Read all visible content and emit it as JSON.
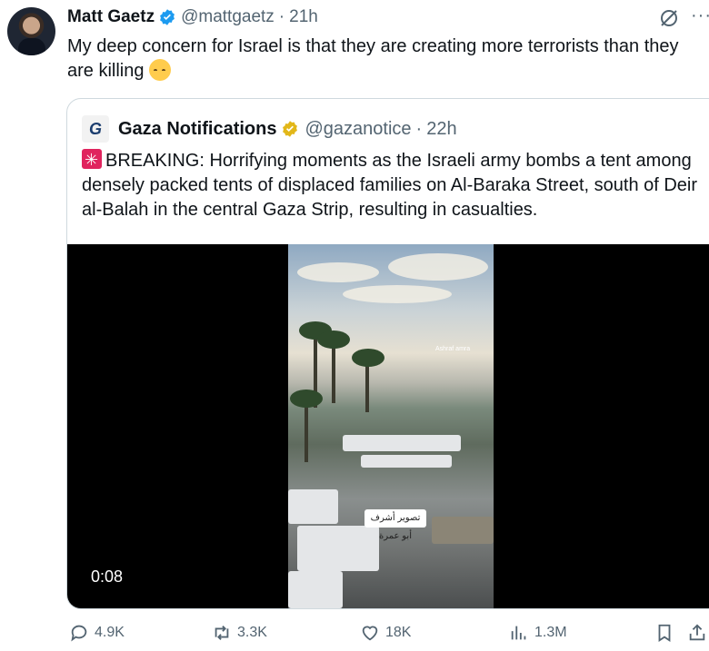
{
  "tweet": {
    "author_name": "Matt Gaetz",
    "handle": "@mattgaetz",
    "separator": "·",
    "time": "21h",
    "text": "My deep concern for Israel is that they are creating more terrorists than they are killing",
    "more_label": "···"
  },
  "quote": {
    "author_name": "Gaza Notifications",
    "avatar_letter": "G",
    "handle": "@gazanotice",
    "separator": "·",
    "time": "22h",
    "text": "BREAKING: Horrifying moments as the Israeli army bombs a tent among densely packed tents of displaced families on Al-Baraka Street, south of Deir al-Balah in the central Gaza Strip, resulting in casualties.",
    "video": {
      "duration": "0:08",
      "caption": "تصوير أشرف أبو عمرة",
      "watermark": "Ashraf amra"
    }
  },
  "actions": {
    "replies": "4.9K",
    "reposts": "3.3K",
    "likes": "18K",
    "views": "1.3M"
  },
  "colors": {
    "text": "#0f1419",
    "secondary": "#536471",
    "verified_blue": "#1d9bf0",
    "verified_gold": "#e2b719",
    "border": "#cfd9de"
  }
}
